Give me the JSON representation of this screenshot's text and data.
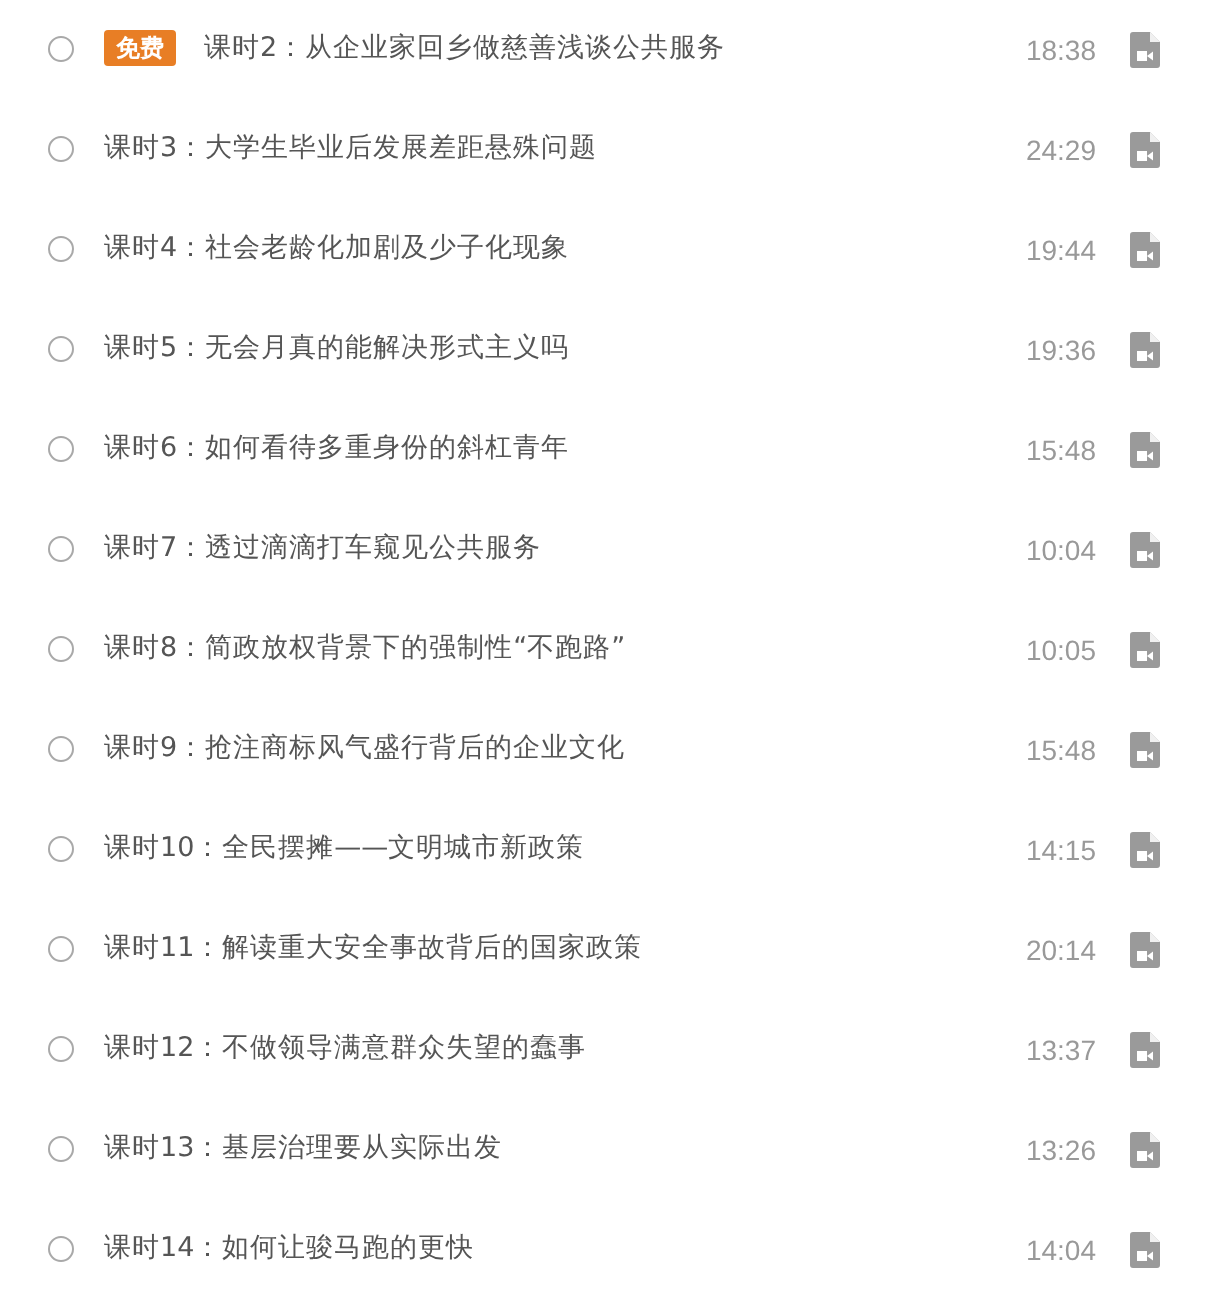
{
  "lessons": [
    {
      "watched": false,
      "badge": "免费",
      "title": "课时2：从企业家回乡做慈善浅谈公共服务",
      "duration": "18:38"
    },
    {
      "watched": false,
      "title": "课时3：大学生毕业后发展差距悬殊问题",
      "duration": "24:29"
    },
    {
      "watched": false,
      "title": "课时4：社会老龄化加剧及少子化现象",
      "duration": "19:44"
    },
    {
      "watched": false,
      "title": "课时5：无会月真的能解决形式主义吗",
      "duration": "19:36"
    },
    {
      "watched": false,
      "title": "课时6：如何看待多重身份的斜杠青年",
      "duration": "15:48"
    },
    {
      "watched": false,
      "title": "课时7：透过滴滴打车窥见公共服务",
      "duration": "10:04"
    },
    {
      "watched": false,
      "title": "课时8：简政放权背景下的强制性“不跑路”",
      "duration": "10:05"
    },
    {
      "watched": false,
      "title": "课时9：抢注商标风气盛行背后的企业文化",
      "duration": "15:48"
    },
    {
      "watched": false,
      "title": "课时10：全民摆摊——文明城市新政策",
      "duration": "14:15"
    },
    {
      "watched": false,
      "title": "课时11：解读重大安全事故背后的国家政策",
      "duration": "20:14"
    },
    {
      "watched": false,
      "title": "课时12：不做领导满意群众失望的蠢事",
      "duration": "13:37"
    },
    {
      "watched": false,
      "title": "课时13：基层治理要从实际出发",
      "duration": "13:26"
    },
    {
      "watched": false,
      "title": "课时14：如何让骏马跑的更快",
      "duration": "14:04"
    }
  ]
}
